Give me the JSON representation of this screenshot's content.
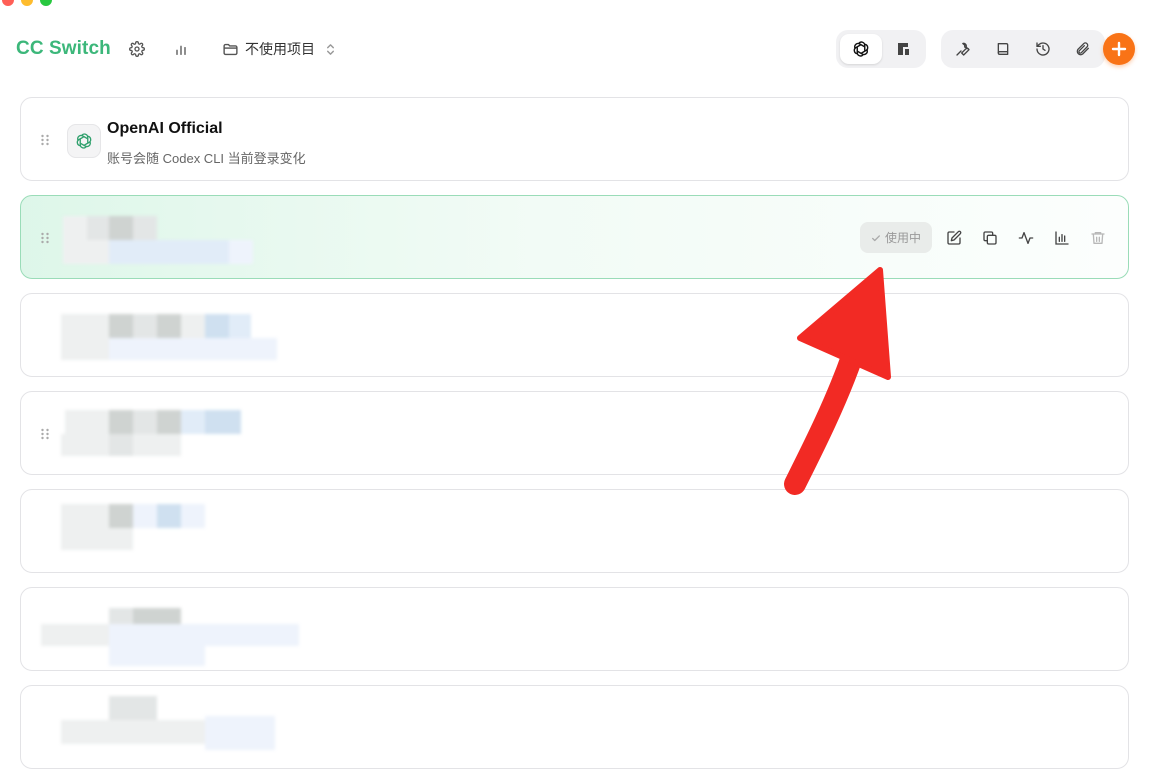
{
  "window": {
    "traffic_lights": [
      "close",
      "minimize",
      "maximize"
    ]
  },
  "header": {
    "app_title": "CC Switch",
    "project_label": "不使用项目",
    "icons": [
      "gear-icon",
      "bar-chart-icon",
      "folder-icon",
      "chevron-updown-icon"
    ],
    "app_switch": [
      "openai-icon",
      "gemini-icon"
    ],
    "tools": [
      "wrench-icon",
      "book-icon",
      "history-icon",
      "paperclip-icon"
    ],
    "add_icon": "plus-icon",
    "accent_color": "#3cb77a",
    "add_color": "#f97316"
  },
  "providers": [
    {
      "name": "OpenAI Official",
      "description": "账号会随 Codex CLI 当前登录变化",
      "icon": "openai-icon"
    },
    {
      "active": true,
      "status_label": "使用中",
      "status_icon": "check-icon",
      "actions": [
        "edit-icon",
        "copy-icon",
        "activity-icon",
        "bar-chart-icon",
        "trash-icon"
      ]
    },
    {
      "redacted": true
    },
    {
      "redacted": true
    },
    {
      "redacted": true
    },
    {
      "redacted": true
    },
    {
      "redacted": true
    }
  ],
  "annotation": {
    "type": "arrow",
    "color": "#f22a24"
  }
}
